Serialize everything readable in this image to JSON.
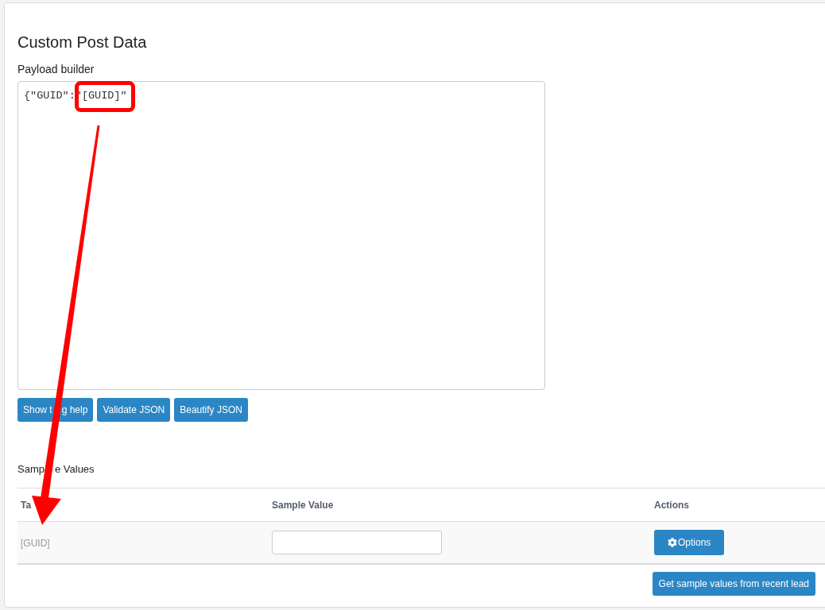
{
  "page": {
    "title": "Custom Post Data"
  },
  "payload_builder": {
    "label": "Payload builder",
    "value": "{\"GUID\":\"[GUID]\""
  },
  "builder_buttons": [
    "Show t g help",
    "Validate JSON",
    "Beautify JSON"
  ],
  "sample_values": {
    "title": "Samp e Values",
    "columns": [
      "Ta",
      "Sample Value",
      "Actions"
    ],
    "rows": [
      {
        "tag": "[GUID]",
        "action": "Options"
      }
    ]
  },
  "footer_button": "Get sample values from recent lead"
}
